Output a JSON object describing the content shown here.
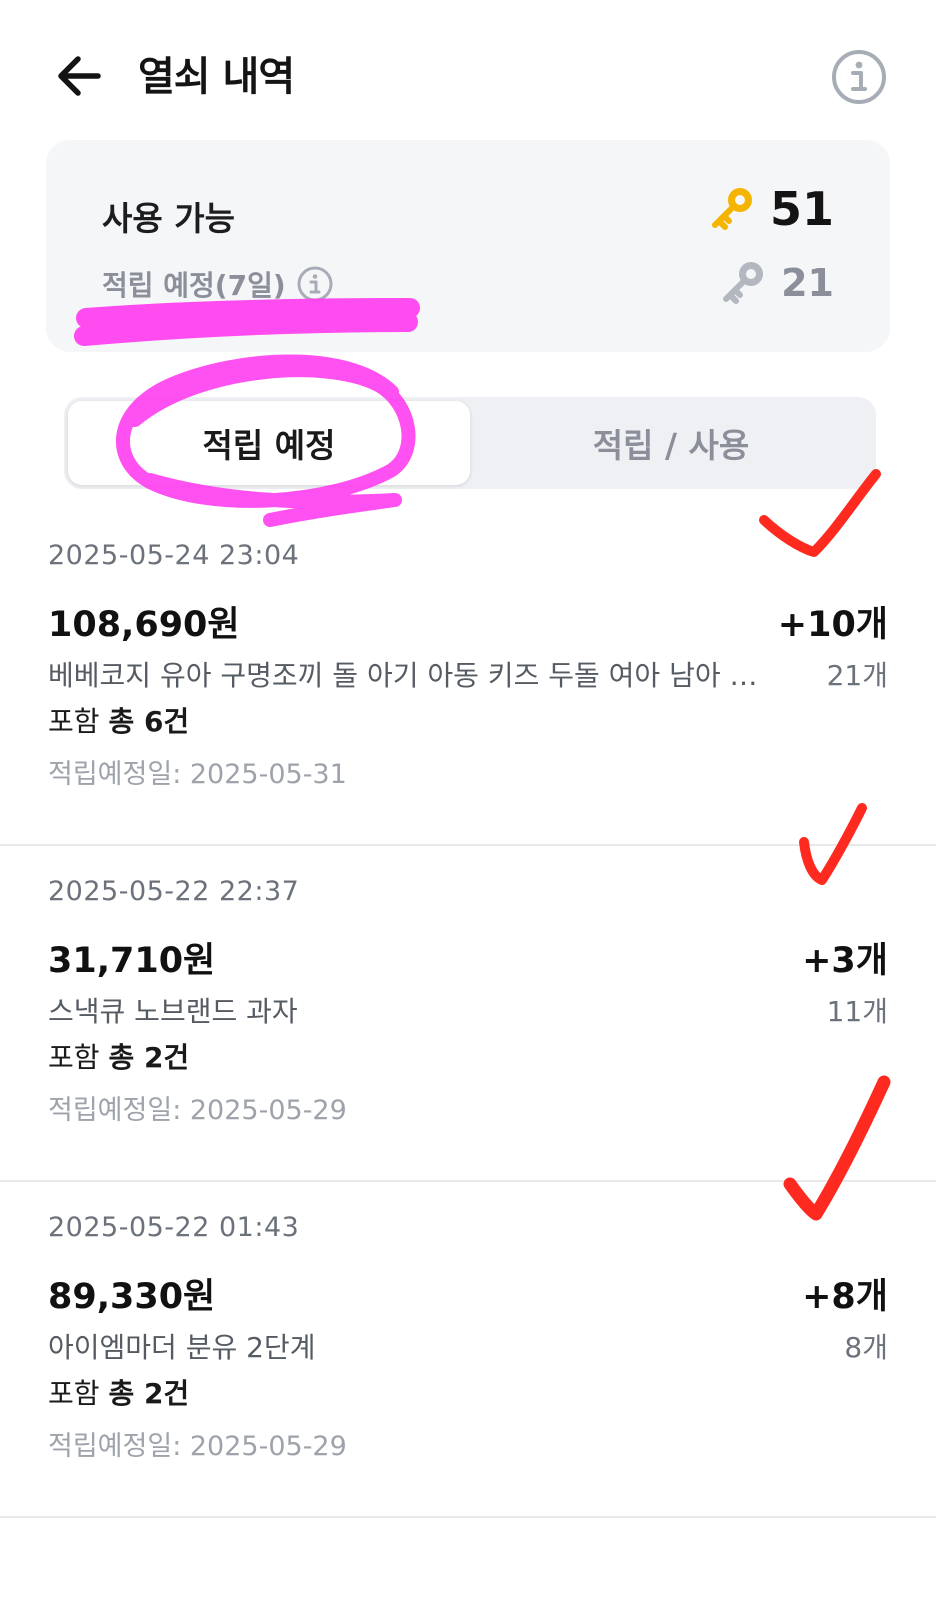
{
  "header": {
    "title": "열쇠 내역",
    "back_icon": "arrow-left-icon",
    "info_icon": "info-circle-icon"
  },
  "summary": {
    "available_label": "사용 가능",
    "available_count": "51",
    "pending_label": "적립 예정(7일)",
    "pending_count": "21",
    "colors": {
      "key_gold": "#f5b400",
      "key_gray": "#a7adb6",
      "card_bg": "#f5f6f8"
    }
  },
  "tabs": [
    {
      "label": "적립 예정",
      "active": true
    },
    {
      "label": "적립 / 사용",
      "active": false
    }
  ],
  "items": [
    {
      "date": "2025-05-24 23:04",
      "amount": "108,690원",
      "keys_plus": "+10개",
      "product": "베베코지 유아 구명조끼 돌 아기 아동 키즈 두돌 여아 남아 수영 조끼",
      "product_count": "21개",
      "include_prefix": "포함",
      "include_total": "총 6건",
      "due": "적립예정일: 2025-05-31"
    },
    {
      "date": "2025-05-22 22:37",
      "amount": "31,710원",
      "keys_plus": "+3개",
      "product": "스낵큐 노브랜드 과자",
      "product_count": "11개",
      "include_prefix": "포함",
      "include_total": "총 2건",
      "due": "적립예정일: 2025-05-29"
    },
    {
      "date": "2025-05-22 01:43",
      "amount": "89,330원",
      "keys_plus": "+8개",
      "product": "아이엠마더 분유 2단계",
      "product_count": "8개",
      "include_prefix": "포함",
      "include_total": "총 2건",
      "due": "적립예정일: 2025-05-29"
    }
  ],
  "annotations": {
    "highlight_color": "#ff3df0",
    "check_color": "#ff2a1f"
  }
}
